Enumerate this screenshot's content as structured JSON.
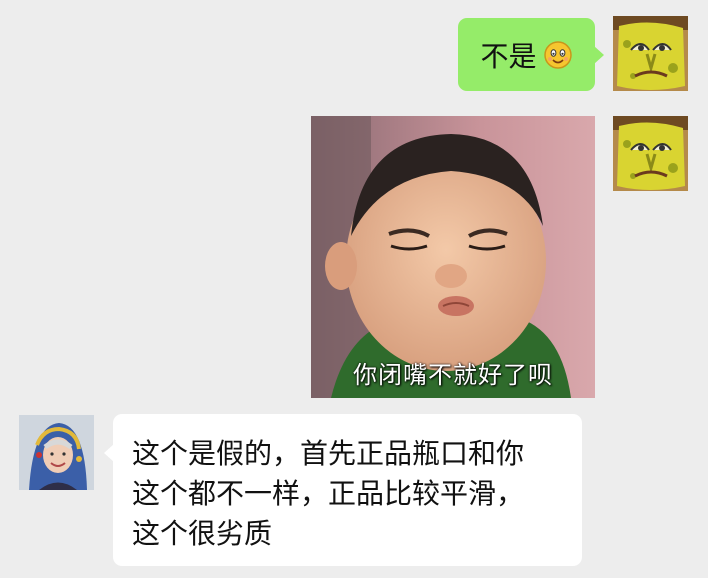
{
  "messages": [
    {
      "sender": "self",
      "type": "text",
      "text": "不是",
      "emoji": "smiley-emoji"
    },
    {
      "sender": "self",
      "type": "sticker",
      "caption": "你闭嘴不就好了呗"
    },
    {
      "sender": "other",
      "type": "text",
      "lines": [
        "这个是假的，首先正品瓶口和你",
        "这个都不一样，正品比较平滑，",
        "这个很劣质"
      ]
    }
  ],
  "avatars": {
    "self": "spongebob-avatar",
    "other": "elderly-woman-headscarf-avatar"
  },
  "colors": {
    "background": "#ededed",
    "outgoing_bubble": "#95ec69",
    "incoming_bubble": "#ffffff"
  }
}
